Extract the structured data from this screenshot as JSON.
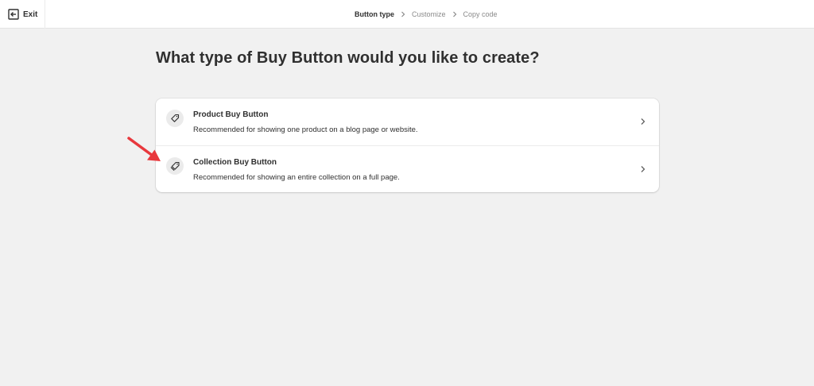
{
  "topbar": {
    "exit_label": "Exit",
    "steps": [
      {
        "label": "Button type",
        "active": true
      },
      {
        "label": "Customize",
        "active": false
      },
      {
        "label": "Copy code",
        "active": false
      }
    ]
  },
  "main": {
    "title": "What type of Buy Button would you like to create?",
    "options": [
      {
        "icon": "tag-icon",
        "title": "Product Buy Button",
        "description": "Recommended for showing one product on a blog page or website."
      },
      {
        "icon": "tags-icon",
        "title": "Collection Buy Button",
        "description": "Recommended for showing an entire collection on a full page."
      }
    ]
  },
  "annotation": {
    "arrow_color": "#e8383d",
    "icon": "red-arrow-icon"
  },
  "colors": {
    "page_bg": "#f1f1f1",
    "card_bg": "#ffffff",
    "text": "#303030",
    "muted": "#8a8a8a"
  }
}
